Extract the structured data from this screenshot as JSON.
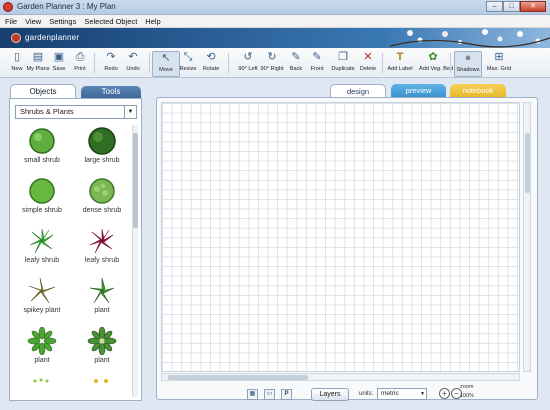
{
  "window": {
    "title": "Garden Planner 3 : My  Plan",
    "controls": [
      "–",
      "□",
      "✕"
    ]
  },
  "menu": [
    "File",
    "View",
    "Settings",
    "Selected Object",
    "Help"
  ],
  "banner": {
    "brand": "gardenplanner"
  },
  "toolbar": [
    {
      "label": "New",
      "icon": "new-file-icon",
      "glyph": "▯"
    },
    {
      "label": "My Plans",
      "icon": "folder-icon",
      "glyph": "▤"
    },
    {
      "label": "Save",
      "icon": "save-icon",
      "glyph": "▣"
    },
    {
      "label": "Print",
      "icon": "print-icon",
      "glyph": "⎙"
    },
    {
      "label": "Redo",
      "icon": "redo-icon",
      "glyph": "↷"
    },
    {
      "label": "Undo",
      "icon": "undo-icon",
      "glyph": "↶"
    },
    {
      "label": "Move",
      "icon": "move-cursor-icon",
      "glyph": "↖"
    },
    {
      "label": "Resize",
      "icon": "resize-icon",
      "glyph": "⤡"
    },
    {
      "label": "Rotate",
      "icon": "rotate-icon",
      "glyph": "⟲"
    },
    {
      "label": "90° Left",
      "icon": "rotate-left-icon",
      "glyph": "↺"
    },
    {
      "label": "90° Right",
      "icon": "rotate-right-icon",
      "glyph": "↻"
    },
    {
      "label": "Back",
      "icon": "send-back-icon",
      "glyph": "✎"
    },
    {
      "label": "Front",
      "icon": "bring-front-icon",
      "glyph": "✎"
    },
    {
      "label": "Duplicate",
      "icon": "duplicate-icon",
      "glyph": "❐"
    },
    {
      "label": "Delete",
      "icon": "delete-icon",
      "glyph": "✕"
    },
    {
      "label": "Add Label",
      "icon": "add-label-icon",
      "glyph": "T"
    },
    {
      "label": "Add Veg. Bed",
      "icon": "add-veg-bed-icon",
      "glyph": "✿"
    },
    {
      "label": "Shadows",
      "icon": "shadows-icon",
      "glyph": "●"
    },
    {
      "label": "Max. Grid",
      "icon": "max-grid-icon",
      "glyph": "⊞"
    }
  ],
  "left_panel": {
    "tabs": [
      "Objects",
      "Tools"
    ],
    "category": "Shrubs & Plants",
    "items": [
      {
        "label": "small shrub",
        "color": "#5fae3e"
      },
      {
        "label": "large shrub",
        "color": "#2f6e22"
      },
      {
        "label": "simple shrub",
        "color": "#66b83f"
      },
      {
        "label": "dense shrub",
        "color": "#7ab852"
      },
      {
        "label": "leafy shrub",
        "color": "#3fc23a"
      },
      {
        "label": "leafy shrub",
        "color": "#b01844"
      },
      {
        "label": "spikey plant",
        "color": "#8a8a2e"
      },
      {
        "label": "plant",
        "color": "#3e9a2e"
      },
      {
        "label": "plant",
        "color": "#4ea436"
      },
      {
        "label": "plant",
        "color": "#4b8f36"
      }
    ]
  },
  "canvas": {
    "tabs": [
      "design",
      "preview",
      "notebook"
    ],
    "bottom": {
      "layers": "Layers",
      "units_label": "units:",
      "units_value": "metric",
      "zoom_label": "zoom",
      "zoom_value": "100%"
    }
  }
}
